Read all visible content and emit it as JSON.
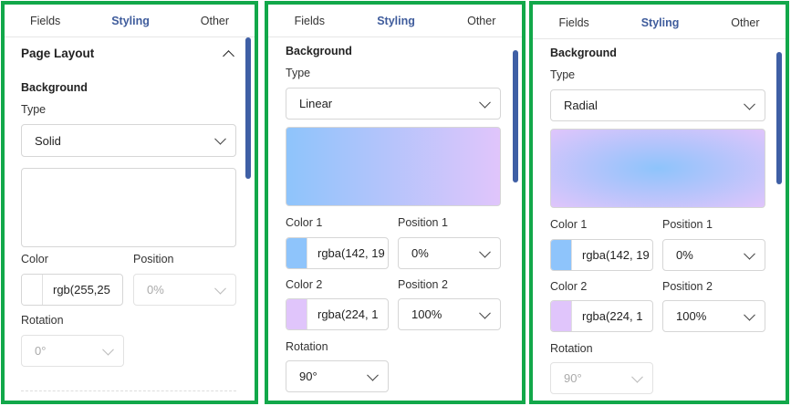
{
  "tabs": {
    "fields": "Fields",
    "styling": "Styling",
    "other": "Other"
  },
  "panel1": {
    "section_title": "Page Layout",
    "background_label": "Background",
    "type_label": "Type",
    "type_value": "Solid",
    "color_label": "Color",
    "color_value": "rgb(255,25",
    "position_label": "Position",
    "position_value": "0%",
    "rotation_label": "Rotation",
    "rotation_value": "0°"
  },
  "panel2": {
    "background_label": "Background",
    "type_label": "Type",
    "type_value": "Linear",
    "color1_label": "Color 1",
    "color1_value": "rgba(142, 19",
    "position1_label": "Position 1",
    "position1_value": "0%",
    "color2_label": "Color 2",
    "color2_value": "rgba(224, 1",
    "position2_label": "Position 2",
    "position2_value": "100%",
    "rotation_label": "Rotation",
    "rotation_value": "90°"
  },
  "panel3": {
    "background_label": "Background",
    "type_label": "Type",
    "type_value": "Radial",
    "color1_label": "Color 1",
    "color1_value": "rgba(142, 19",
    "position1_label": "Position 1",
    "position1_value": "0%",
    "color2_label": "Color 2",
    "color2_value": "rgba(224, 1",
    "position2_label": "Position 2",
    "position2_value": "100%",
    "rotation_label": "Rotation",
    "rotation_value": "90°"
  },
  "colors": {
    "frame": "#12a84a",
    "accent": "#3f5c9c",
    "color1": "#8ec4fb",
    "color2": "#e0c5fb"
  }
}
